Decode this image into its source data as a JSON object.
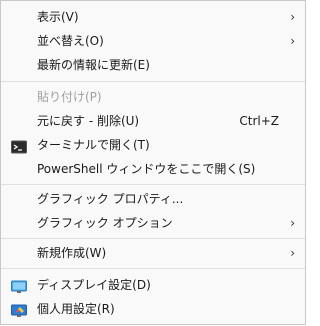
{
  "menu": {
    "items": [
      {
        "label": "表示(V)",
        "arrow": "›"
      },
      {
        "label": "並べ替え(O)",
        "arrow": "›"
      },
      {
        "label": "最新の情報に更新(E)"
      },
      {
        "label": "貼り付け(P)"
      },
      {
        "label": "元に戻す - 削除(U)",
        "shortcut": "Ctrl+Z"
      },
      {
        "label": "ターミナルで開く(T)",
        "icon": "terminal-icon"
      },
      {
        "label": "PowerShell ウィンドウをここで開く(S)"
      },
      {
        "label": "グラフィック プロパティ..."
      },
      {
        "label": "グラフィック オプション",
        "arrow": "›"
      },
      {
        "label": "新規作成(W)",
        "arrow": "›"
      },
      {
        "label": "ディスプレイ設定(D)",
        "icon": "display-icon"
      },
      {
        "label": "個人用設定(R)",
        "icon": "personalize-icon"
      }
    ],
    "disabled": [
      "貼り付け(P)"
    ]
  }
}
